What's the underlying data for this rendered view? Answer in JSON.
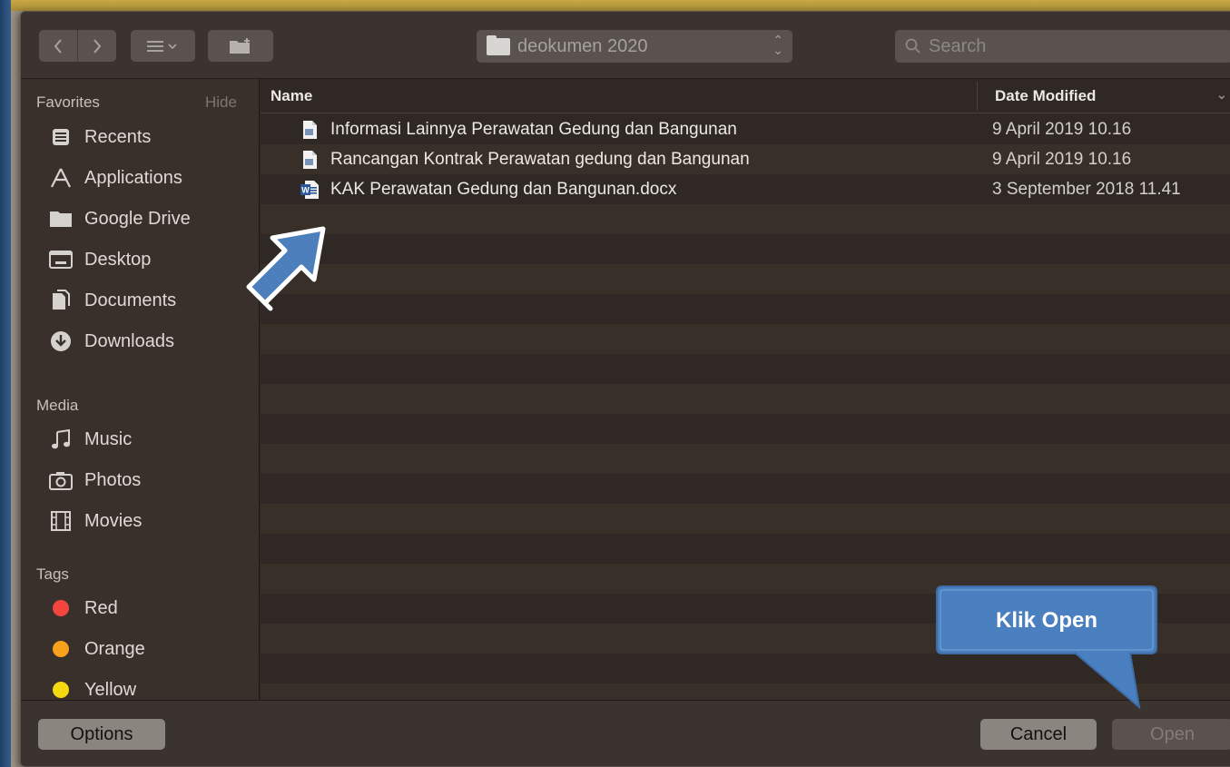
{
  "toolbar": {
    "back_icon": "chevron-left-icon",
    "forward_icon": "chevron-right-icon",
    "view_icon": "list-view-icon",
    "new_folder_icon": "new-folder-icon",
    "location": "deokumen 2020",
    "search_placeholder": "Search"
  },
  "sidebar": {
    "favorites_label": "Favorites",
    "hide_label": "Hide",
    "favorites": [
      {
        "label": "Recents",
        "icon": "recents-icon"
      },
      {
        "label": "Applications",
        "icon": "applications-icon"
      },
      {
        "label": "Google Drive",
        "icon": "folder-icon"
      },
      {
        "label": "Desktop",
        "icon": "desktop-icon"
      },
      {
        "label": "Documents",
        "icon": "documents-icon"
      },
      {
        "label": "Downloads",
        "icon": "downloads-icon"
      }
    ],
    "media_label": "Media",
    "media": [
      {
        "label": "Music",
        "icon": "music-icon"
      },
      {
        "label": "Photos",
        "icon": "camera-icon"
      },
      {
        "label": "Movies",
        "icon": "film-icon"
      }
    ],
    "tags_label": "Tags",
    "tags": [
      {
        "label": "Red",
        "color": "#f2453d"
      },
      {
        "label": "Orange",
        "color": "#f7a21b"
      },
      {
        "label": "Yellow",
        "color": "#f5d80f"
      }
    ]
  },
  "files": {
    "col_name": "Name",
    "col_date": "Date Modified",
    "rows": [
      {
        "name": "Informasi Lainnya Perawatan Gedung dan Bangunan",
        "date": "9 April 2019 10.16",
        "icon": "document-icon"
      },
      {
        "name": "Rancangan Kontrak Perawatan gedung dan Bangunan",
        "date": "9 April 2019 10.16",
        "icon": "document-icon"
      },
      {
        "name": "KAK Perawatan Gedung dan Bangunan.docx",
        "date": "3 September 2018 11.41",
        "icon": "word-doc-icon"
      }
    ]
  },
  "bottom": {
    "options": "Options",
    "cancel": "Cancel",
    "open": "Open"
  },
  "annotation": {
    "callout": "Klik Open",
    "callout_color": "#4a7fc0"
  }
}
